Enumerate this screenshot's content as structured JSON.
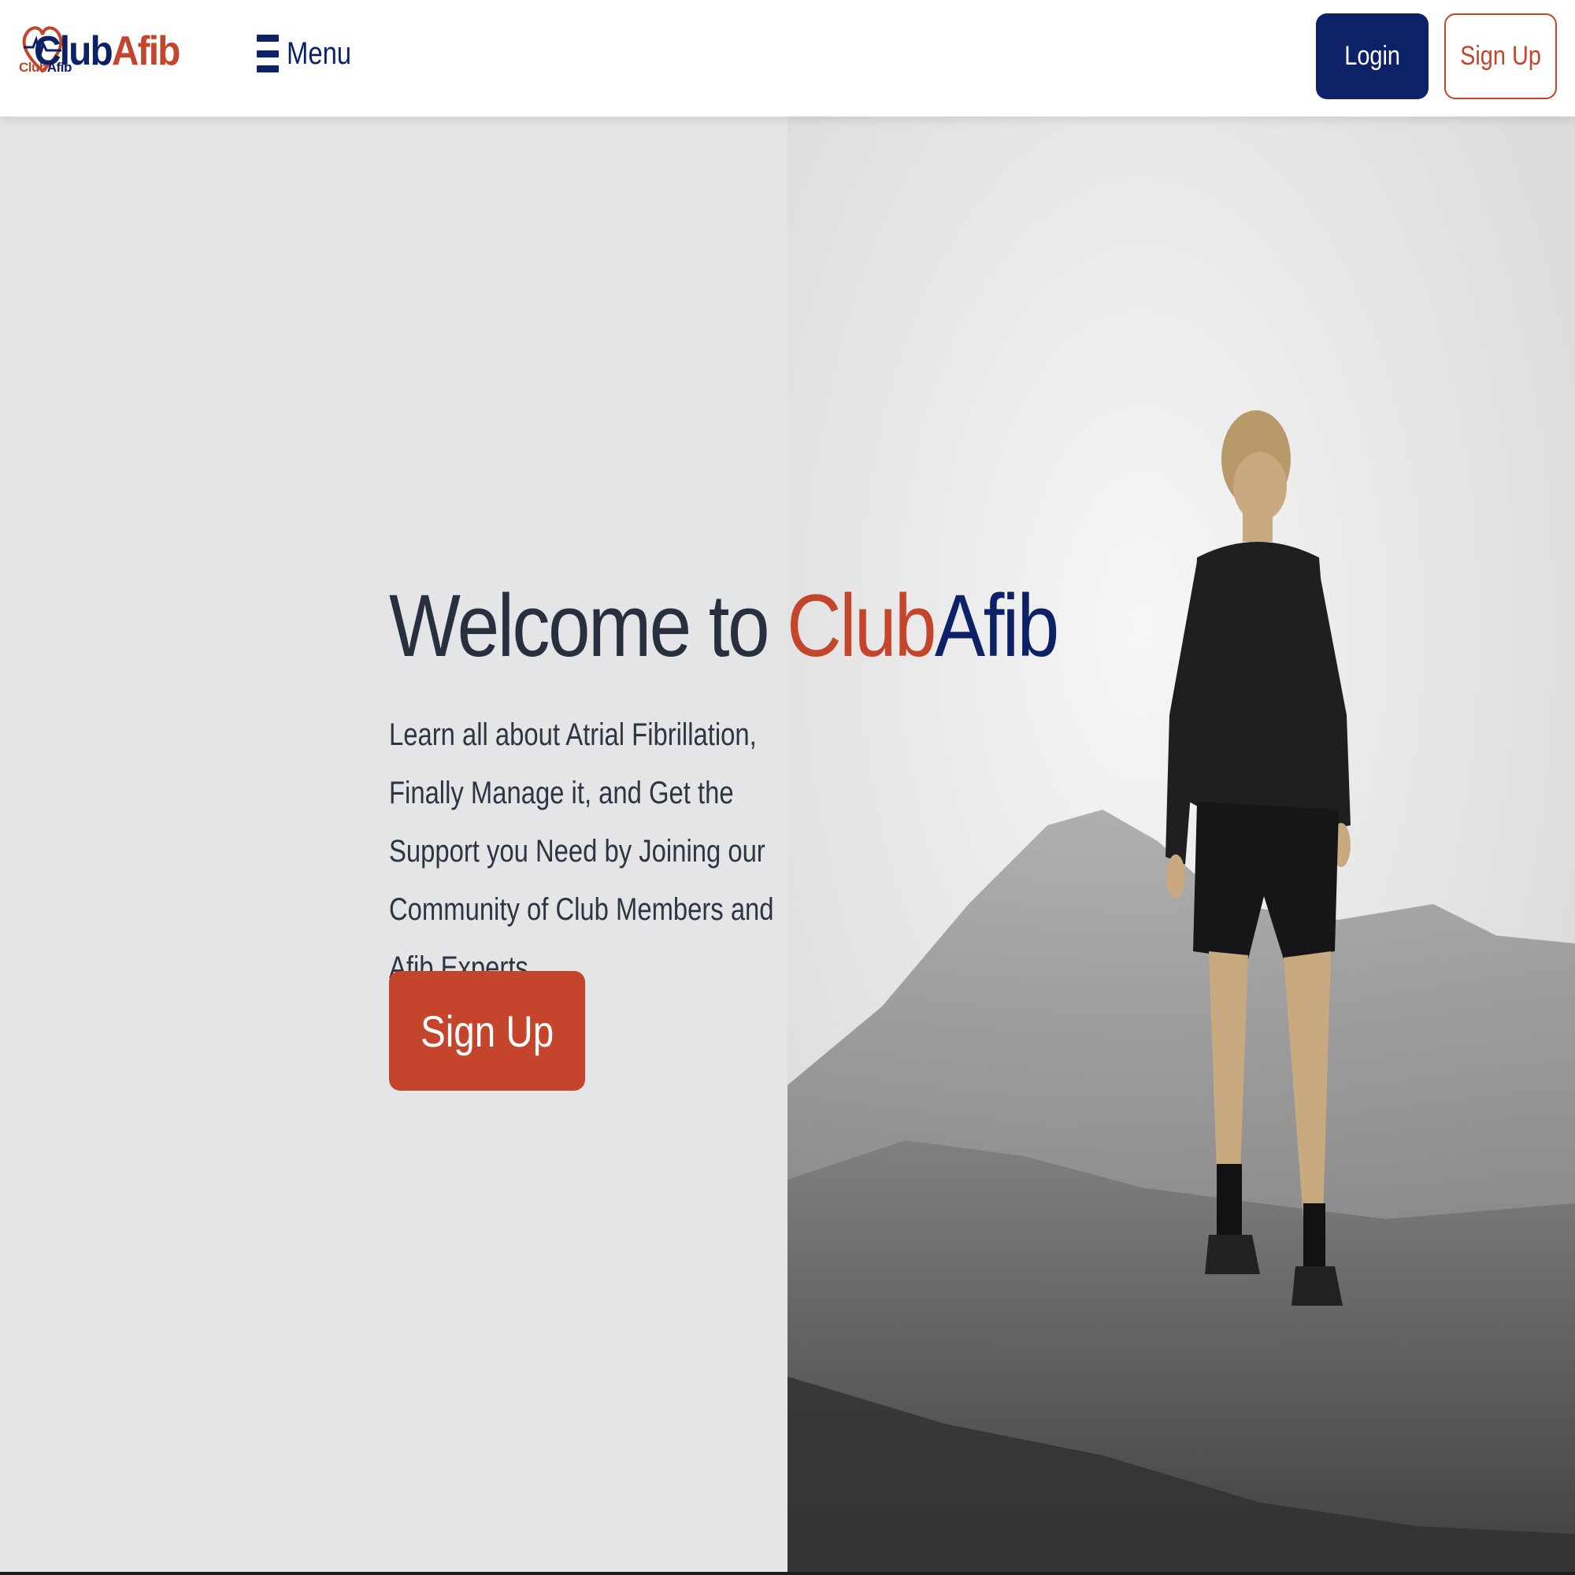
{
  "header": {
    "logo": {
      "mark_text_1": "Club",
      "mark_text_2": "Afib",
      "word_1": "Club",
      "word_2": "Afib"
    },
    "menu_label": "Menu",
    "login_label": "Login",
    "signup_label": "Sign Up"
  },
  "hero": {
    "title_prefix": "Welcome to ",
    "title_club": "Club",
    "title_afib": "Afib",
    "subtitle": "Learn all about Atrial Fibrillation, Finally Manage it, and Get the Support you Need by Joining our Community of Club Members and Afib Experts",
    "cta_label": "Sign Up"
  },
  "colors": {
    "brand_navy": "#0d2266",
    "brand_red": "#c4452b",
    "hero_bg": "#e4e5e7",
    "text_dark": "#28303f"
  },
  "icons": [
    "heart-logo-icon",
    "hamburger-icon"
  ]
}
